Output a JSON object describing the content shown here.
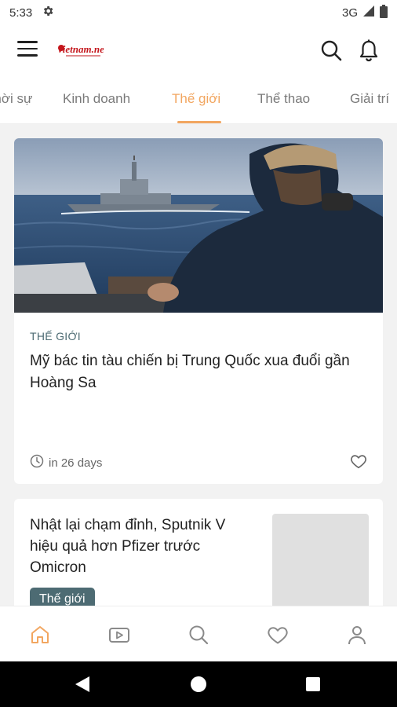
{
  "status_bar": {
    "time": "5:33",
    "network": "3G"
  },
  "header": {
    "logo_text": "vietnam.net"
  },
  "tabs": [
    {
      "label": "Thời sự"
    },
    {
      "label": "Kinh doanh"
    },
    {
      "label": "Thế giới",
      "active": true
    },
    {
      "label": "Thể thao"
    },
    {
      "label": "Giải trí"
    }
  ],
  "featured": {
    "category": "THẾ GIỚI",
    "headline": "Mỹ bác tin tàu chiến bị Trung Quốc xua đuổi gần Hoàng Sa",
    "time": "in 26 days"
  },
  "second": {
    "headline": "Nhật lại chạm đỉnh, Sputnik V hiệu quả hơn Pfizer trước Omicron",
    "badge": "Thế giới"
  },
  "bottom_nav": [
    "home-icon",
    "video-icon",
    "search-icon",
    "heart-icon",
    "profile-icon"
  ],
  "colors": {
    "accent": "#f2a660",
    "category": "#4d6b73"
  }
}
